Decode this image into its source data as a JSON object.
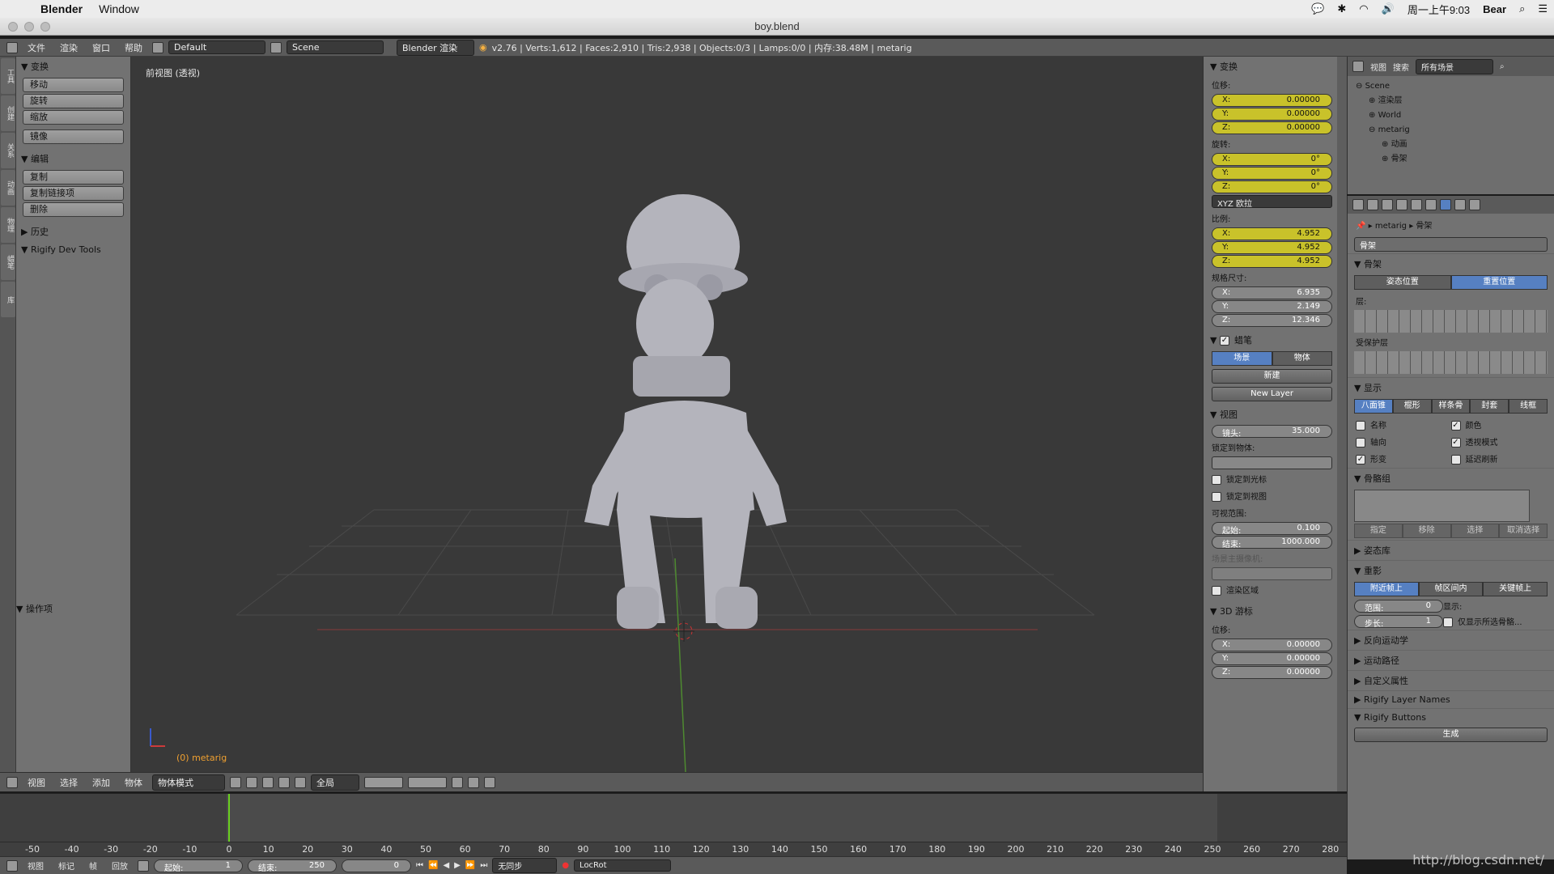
{
  "mac_menu": {
    "apple": "",
    "app": "Blender",
    "window": "Window",
    "right": [
      "周一上午9:03",
      "Bear"
    ]
  },
  "title": "boy.blend",
  "info": {
    "menus": [
      "文件",
      "渲染",
      "窗口",
      "帮助"
    ],
    "layout": "Default",
    "scene": "Scene",
    "engine": "Blender 渲染",
    "stats": "v2.76 | Verts:1,612 | Faces:2,910 | Tris:2,938 | Objects:0/3 | Lamps:0/0 | 内存:38.48M | metarig"
  },
  "toolshelf": {
    "tabs": [
      "工具",
      "创建",
      "关系",
      "动画",
      "物理",
      "蜡笔",
      "库"
    ],
    "transform_title": "变换",
    "transform_buttons": [
      "移动",
      "旋转",
      "缩放",
      "镜像"
    ],
    "edit_title": "编辑",
    "edit_buttons": [
      "复制",
      "复制链接项",
      "删除"
    ],
    "history": "历史",
    "rigify": "Rigify Dev Tools",
    "operator": "操作项"
  },
  "viewport": {
    "label": "前视图 (透视)",
    "object": "(0) metarig"
  },
  "view_header": {
    "menus": [
      "视图",
      "选择",
      "添加",
      "物体"
    ],
    "mode": "物体模式",
    "orientation": "全局"
  },
  "npanel": {
    "transform": "变换",
    "location": "位移:",
    "loc": [
      {
        "k": "X:",
        "v": "0.00000"
      },
      {
        "k": "Y:",
        "v": "0.00000"
      },
      {
        "k": "Z:",
        "v": "0.00000"
      }
    ],
    "rotation": "旋转:",
    "rot": [
      {
        "k": "X:",
        "v": "0°"
      },
      {
        "k": "Y:",
        "v": "0°"
      },
      {
        "k": "Z:",
        "v": "0°"
      }
    ],
    "euler": "XYZ 欧拉",
    "scale": "比例:",
    "scl": [
      {
        "k": "X:",
        "v": "4.952"
      },
      {
        "k": "Y:",
        "v": "4.952"
      },
      {
        "k": "Z:",
        "v": "4.952"
      }
    ],
    "dimensions": "规格尺寸:",
    "dim": [
      {
        "k": "X:",
        "v": "6.935"
      },
      {
        "k": "Y:",
        "v": "2.149"
      },
      {
        "k": "Z:",
        "v": "12.346"
      }
    ],
    "grease": "蜡笔",
    "grease_tabs": [
      "场景",
      "物体"
    ],
    "new": "新建",
    "new_layer": "New Layer",
    "view": "视图",
    "lens": "镜头:",
    "lens_val": "35.000",
    "lock_obj": "锁定到物体:",
    "lock_cursor": "锁定到光标",
    "lock_view": "锁定到视图",
    "clip": "可视范围:",
    "clip_start": "起始:",
    "clip_start_val": "0.100",
    "clip_end": "结束:",
    "clip_end_val": "1000.000",
    "local_cam": "场景主摄像机:",
    "render_border": "渲染区域",
    "cursor3d": "3D 游标",
    "cursor_loc": "位移:",
    "cur": [
      {
        "k": "X:",
        "v": "0.00000"
      },
      {
        "k": "Y:",
        "v": "0.00000"
      },
      {
        "k": "Z:",
        "v": "0.00000"
      }
    ]
  },
  "outliner": {
    "menus": [
      "视图",
      "搜索"
    ],
    "filter": "所有场景",
    "items": [
      {
        "t": "Scene",
        "d": 0
      },
      {
        "t": "渲染层",
        "d": 1
      },
      {
        "t": "World",
        "d": 1
      },
      {
        "t": "metarig",
        "d": 1
      },
      {
        "t": "动画",
        "d": 2
      },
      {
        "t": "骨架",
        "d": 2
      }
    ]
  },
  "props": {
    "crumb": [
      "metarig",
      "骨架"
    ],
    "name": "骨架",
    "skeleton": "骨架",
    "pose_tabs": [
      "姿态位置",
      "重置位置"
    ],
    "layers": "层:",
    "protected": "受保护层",
    "display": "显示",
    "display_tabs": [
      "八面锥",
      "棍形",
      "样条骨",
      "封套",
      "线框"
    ],
    "checks": [
      {
        "l": "名称",
        "c": false
      },
      {
        "l": "颜色",
        "c": true
      },
      {
        "l": "轴向",
        "c": false
      },
      {
        "l": "透视模式",
        "c": true
      },
      {
        "l": "形变",
        "c": true
      },
      {
        "l": "延迟刷新",
        "c": false
      }
    ],
    "bone_groups": "骨骼组",
    "group_btns": [
      "指定",
      "移除",
      "选择",
      "取消选择"
    ],
    "pose_lib": "姿态库",
    "ghost": "重影",
    "ghost_tabs": [
      "附近帧上",
      "帧区间内",
      "关键帧上"
    ],
    "range": "范围:",
    "range_val": "0",
    "step": "步长:",
    "step_val": "1",
    "show": "显示:",
    "sel_only": "仅显示所选骨骼...",
    "ik": "反向运动学",
    "motion": "运动路径",
    "custom": "自定义属性",
    "rig_layers": "Rigify Layer Names",
    "rig_buttons": "Rigify Buttons",
    "generate": "生成",
    "watermark": "http://blog.csdn.net/"
  },
  "timeline": {
    "ticks": [
      "-50",
      "-40",
      "-30",
      "-20",
      "-10",
      "0",
      "10",
      "20",
      "30",
      "40",
      "50",
      "60",
      "70",
      "80",
      "90",
      "100",
      "110",
      "120",
      "130",
      "140",
      "150",
      "160",
      "170",
      "180",
      "190",
      "200",
      "210",
      "220",
      "230",
      "240",
      "250",
      "260",
      "270",
      "280"
    ],
    "menus": [
      "视图",
      "标记",
      "帧",
      "回放"
    ],
    "start": "起始:",
    "start_val": "1",
    "end": "结束:",
    "end_val": "250",
    "frame": "0",
    "sync": "无同步",
    "keyset": "LocRot"
  }
}
